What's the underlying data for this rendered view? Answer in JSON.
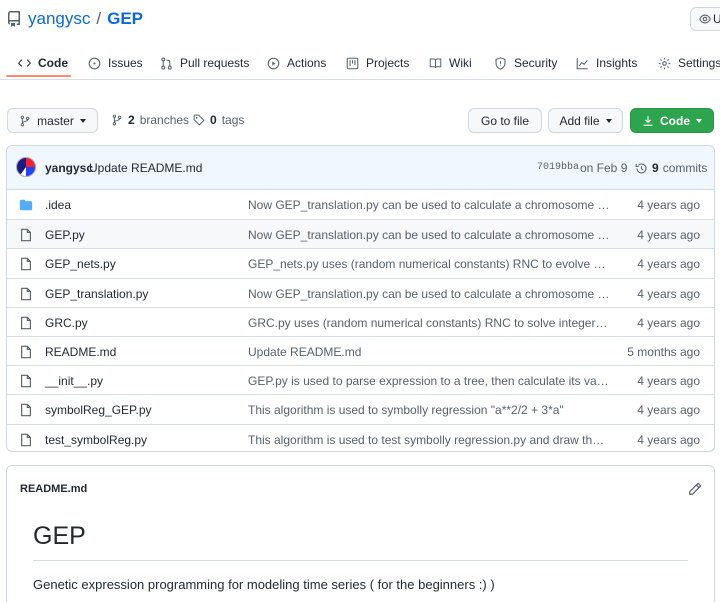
{
  "repo": {
    "owner": "yangysc",
    "separator": "/",
    "name": "GEP",
    "watch_label": "U"
  },
  "tabs": [
    {
      "label": "Code",
      "icon": "code-icon"
    },
    {
      "label": "Issues",
      "icon": "issue-icon"
    },
    {
      "label": "Pull requests",
      "icon": "pull-request-icon"
    },
    {
      "label": "Actions",
      "icon": "play-icon"
    },
    {
      "label": "Projects",
      "icon": "project-icon"
    },
    {
      "label": "Wiki",
      "icon": "book-icon"
    },
    {
      "label": "Security",
      "icon": "shield-icon"
    },
    {
      "label": "Insights",
      "icon": "graph-icon"
    },
    {
      "label": "Settings",
      "icon": "gear-icon"
    }
  ],
  "toolbar": {
    "branch": "master",
    "branches_count": "2",
    "branches_label": "branches",
    "tags_count": "0",
    "tags_label": "tags",
    "go_to_file": "Go to file",
    "add_file": "Add file",
    "code": "Code"
  },
  "latest_commit": {
    "author": "yangysc",
    "message": "Update README.md",
    "sha": "7019bba",
    "date": "on Feb 9",
    "count": "9",
    "count_label": "commits"
  },
  "files": [
    {
      "name": ".idea",
      "type": "dir",
      "message": "Now GEP_translation.py can be used to calculate a chromosome who is ...",
      "age": "4 years ago"
    },
    {
      "name": "GEP.py",
      "type": "file",
      "message": "Now GEP_translation.py can be used to calculate a chromosome who is ...",
      "age": "4 years ago"
    },
    {
      "name": "GEP_nets.py",
      "type": "file",
      "message": "GEP_nets.py uses (random numerical constants) RNC to evolve neron ne...",
      "age": "4 years ago"
    },
    {
      "name": "GEP_translation.py",
      "type": "file",
      "message": "Now GEP_translation.py can be used to calculate a chromosome who is ...",
      "age": "4 years ago"
    },
    {
      "name": "GRC.py",
      "type": "file",
      "message": "GRC.py uses (random numerical constants) RNC to solve integer symbol ...",
      "age": "4 years ago"
    },
    {
      "name": "README.md",
      "type": "file",
      "message": "Update README.md",
      "age": "5 months ago"
    },
    {
      "name": "__init__.py",
      "type": "file",
      "message": "GEP.py is used to parse expression to a tree, then calculate its value.",
      "age": "4 years ago"
    },
    {
      "name": "symbolReg_GEP.py",
      "type": "file",
      "message": "This algorithm is used to symbolly regression \"a**2/2 + 3*a\"",
      "age": "4 years ago"
    },
    {
      "name": "test_symbolReg.py",
      "type": "file",
      "message": "This algorithm is used to test symbolly regression.py and draw the be...",
      "age": "4 years ago"
    }
  ],
  "readme": {
    "header": "README.md",
    "title": "GEP",
    "description": "Genetic expression programming for modeling time series ( for the beginners :) )"
  },
  "colors": {
    "accent": "#0969da",
    "primary_button": "#2da44e",
    "tab_underline": "#fd8c73",
    "folder": "#54aeff",
    "commit_bar": "#f0f7ff"
  }
}
